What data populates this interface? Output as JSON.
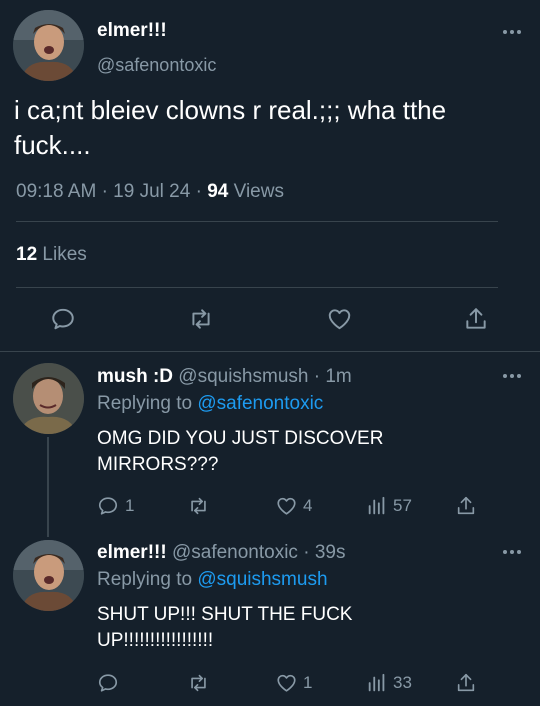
{
  "main_tweet": {
    "display_name": "elmer!!!",
    "handle": "@safenontoxic",
    "text_line1": "i ca;nt bleiev clowns r real.;;; wha tthe",
    "text_line2": "fuck....",
    "time": "09:18 AM",
    "sep1": "·",
    "date": "19 Jul 24",
    "sep2": "·",
    "views_count": "94",
    "views_label": "Views",
    "likes_count": "12",
    "likes_label": "Likes"
  },
  "replies": [
    {
      "display_name": "mush :D",
      "handle": "@squishsmush",
      "time": "· 1m",
      "replying_prefix": "Replying to",
      "replying_handle": "@safenontoxic",
      "text_line1": "OMG DID YOU JUST DISCOVER",
      "text_line2": "MIRRORS???",
      "reply_count": "1",
      "retweet_count": "",
      "like_count": "4",
      "view_count": "57"
    },
    {
      "display_name": "elmer!!!",
      "handle": "@safenontoxic",
      "time": "· 39s",
      "replying_prefix": "Replying to",
      "replying_handle": "@squishsmush",
      "text_line1": "SHUT UP!!! SHUT THE FUCK",
      "text_line2": "UP!!!!!!!!!!!!!!!!!",
      "reply_count": "",
      "retweet_count": "",
      "like_count": "1",
      "view_count": "33"
    }
  ],
  "icons": {
    "more": "more-horizontal-icon",
    "reply": "reply-icon",
    "retweet": "retweet-icon",
    "like": "heart-icon",
    "share": "share-icon",
    "views": "analytics-icon"
  },
  "colors": {
    "background": "#15202b",
    "text": "#ffffff",
    "muted": "#8899a6",
    "link": "#1d9bf0",
    "divider": "#38444d"
  }
}
